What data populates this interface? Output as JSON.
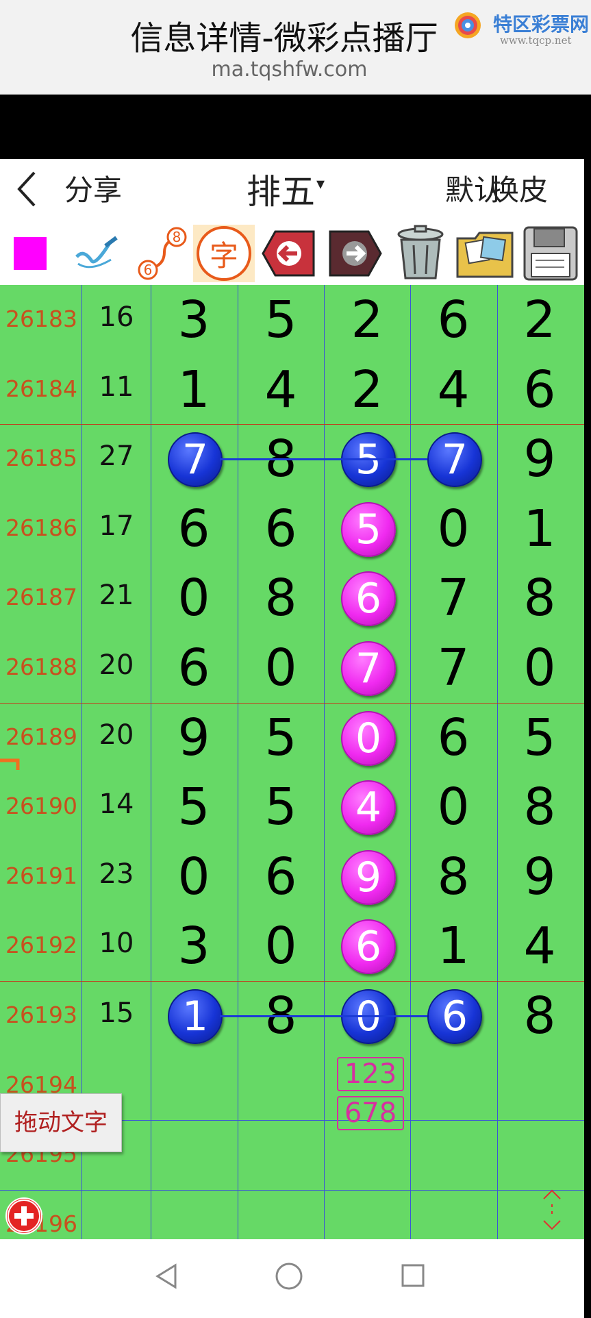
{
  "browser": {
    "title": "信息详情-微彩点播厅",
    "url": "ma.tqshfw.com",
    "watermark_name": "特区彩票网",
    "watermark_url": "www.tqcp.net"
  },
  "header": {
    "back_icon": "chevron-left-icon",
    "share_label": "分享",
    "lottery_name": "排五",
    "caret": "▾",
    "default_label": "默认",
    "skin_label": "换皮"
  },
  "toolbar": {
    "icons": [
      "color-square-icon",
      "pen-check-icon",
      "path-6-8-icon",
      "text-char-icon",
      "undo-arrow-icon",
      "redo-arrow-icon",
      "trash-icon",
      "photo-folder-icon",
      "save-disk-icon"
    ],
    "text_char": "字",
    "path_start": "6",
    "path_end": "8",
    "accent_color": "#ff00ff"
  },
  "rows": [
    {
      "issue": "26183",
      "sum": "16",
      "digits": [
        "3",
        "5",
        "2",
        "6",
        "2"
      ]
    },
    {
      "issue": "26184",
      "sum": "11",
      "digits": [
        "1",
        "4",
        "2",
        "4",
        "6"
      ]
    },
    {
      "issue": "26185",
      "sum": "27",
      "digits": [
        "7",
        "8",
        "5",
        "7",
        "9"
      ]
    },
    {
      "issue": "26186",
      "sum": "17",
      "digits": [
        "6",
        "6",
        "5",
        "0",
        "1"
      ]
    },
    {
      "issue": "26187",
      "sum": "21",
      "digits": [
        "0",
        "8",
        "6",
        "7",
        "8"
      ]
    },
    {
      "issue": "26188",
      "sum": "20",
      "digits": [
        "6",
        "0",
        "7",
        "7",
        "0"
      ]
    },
    {
      "issue": "26189",
      "sum": "20",
      "digits": [
        "9",
        "5",
        "0",
        "6",
        "5"
      ]
    },
    {
      "issue": "26190",
      "sum": "14",
      "digits": [
        "5",
        "5",
        "4",
        "0",
        "8"
      ]
    },
    {
      "issue": "26191",
      "sum": "23",
      "digits": [
        "0",
        "6",
        "9",
        "8",
        "9"
      ]
    },
    {
      "issue": "26192",
      "sum": "10",
      "digits": [
        "3",
        "0",
        "6",
        "1",
        "4"
      ]
    },
    {
      "issue": "26193",
      "sum": "15",
      "digits": [
        "1",
        "8",
        "0",
        "6",
        "8"
      ]
    },
    {
      "issue": "26194",
      "sum": "",
      "digits": [
        "",
        "",
        "",
        "",
        ""
      ]
    },
    {
      "issue": "26195",
      "sum": "",
      "digits": [
        "",
        "",
        "",
        "",
        ""
      ]
    },
    {
      "issue": "26196",
      "sum": "",
      "digits": [
        "",
        "",
        "",
        "",
        ""
      ]
    }
  ],
  "marks": {
    "blue_balls": [
      {
        "row": 2,
        "col": 0
      },
      {
        "row": 2,
        "col": 2
      },
      {
        "row": 2,
        "col": 3
      },
      {
        "row": 10,
        "col": 0
      },
      {
        "row": 10,
        "col": 2
      },
      {
        "row": 10,
        "col": 3
      }
    ],
    "magenta_balls": [
      {
        "row": 3,
        "col": 2
      },
      {
        "row": 4,
        "col": 2
      },
      {
        "row": 5,
        "col": 2
      },
      {
        "row": 6,
        "col": 2
      },
      {
        "row": 7,
        "col": 2
      },
      {
        "row": 8,
        "col": 2
      },
      {
        "row": 9,
        "col": 2
      }
    ],
    "ball_color_blue": "#1734d6",
    "ball_color_magenta": "#f02af0"
  },
  "prediction": {
    "line1": "123",
    "line2": "678"
  },
  "controls": {
    "drag_text_label": "拖动文字",
    "add_icon": "plus-circle-icon",
    "scroll_icon": "scroll-updown-icon"
  },
  "nav": {
    "back_icon": "triangle-back-icon",
    "home_icon": "circle-home-icon",
    "recent_icon": "square-recent-icon"
  }
}
